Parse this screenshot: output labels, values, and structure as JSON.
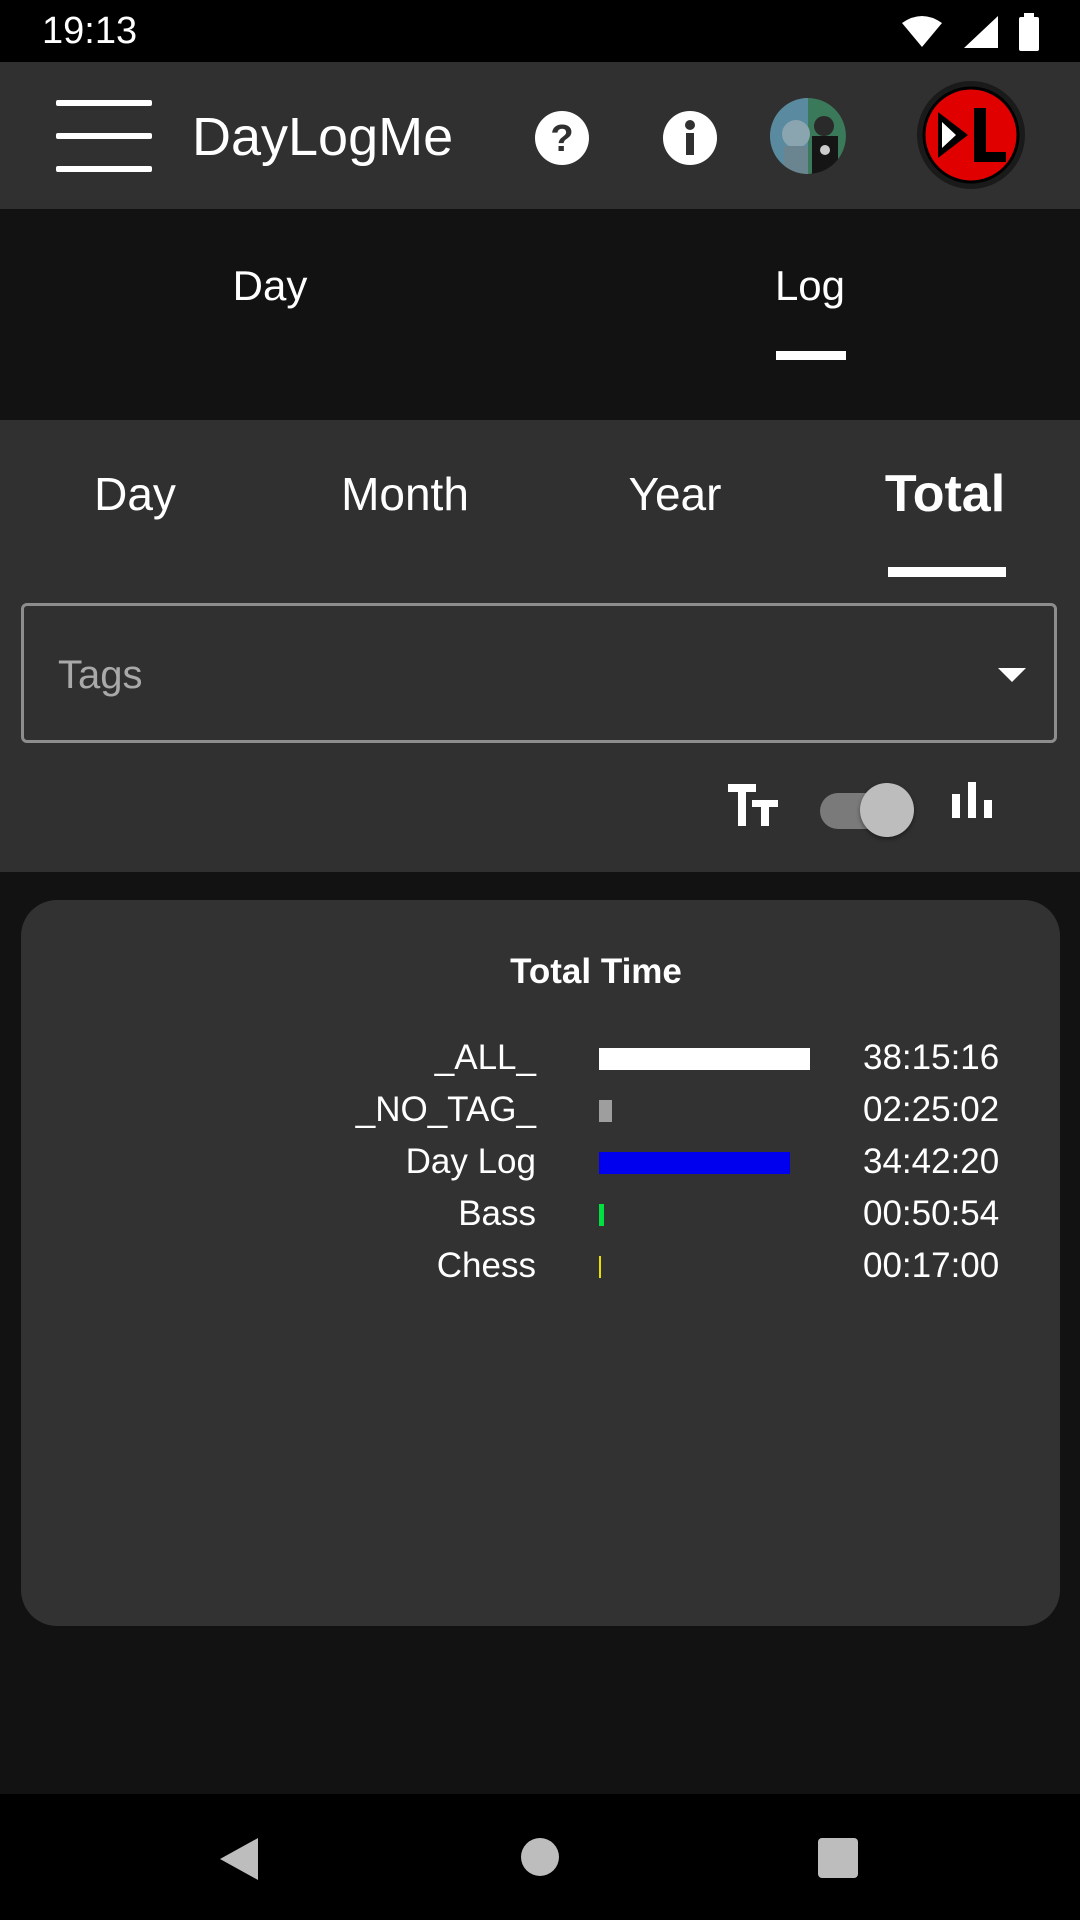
{
  "status_bar": {
    "time": "19:13",
    "icons": [
      "wifi-icon",
      "cell-signal-icon",
      "battery-icon"
    ]
  },
  "app_bar": {
    "title": "DayLogMe",
    "icons": [
      "menu-icon",
      "help-icon",
      "info-icon",
      "avatar",
      "app-logo"
    ]
  },
  "main_tabs": {
    "items": [
      {
        "label": "Day",
        "selected": false
      },
      {
        "label": "Log",
        "selected": true
      }
    ]
  },
  "sub_tabs": {
    "items": [
      {
        "label": "Day",
        "selected": false
      },
      {
        "label": "Month",
        "selected": false
      },
      {
        "label": "Year",
        "selected": false
      },
      {
        "label": "Total",
        "selected": true
      }
    ]
  },
  "tags_select": {
    "placeholder": "Tags"
  },
  "view_toggle": {
    "left_icon": "text-size-icon",
    "right_icon": "bar-chart-icon",
    "checked": true
  },
  "card": {
    "title": "Total Time",
    "rows": [
      {
        "label": "_ALL_",
        "value": "38:15:16",
        "bar_fraction": 1.0,
        "color": "#ffffff"
      },
      {
        "label": "_NO_TAG_",
        "value": "02:25:02",
        "bar_fraction": 0.063,
        "color": "#9e9e9e"
      },
      {
        "label": "Day Log",
        "value": "34:42:20",
        "bar_fraction": 0.907,
        "color": "#0000ee"
      },
      {
        "label": "Bass",
        "value": "00:50:54",
        "bar_fraction": 0.022,
        "color": "#00e040"
      },
      {
        "label": "Chess",
        "value": "00:17:00",
        "bar_fraction": 0.0074,
        "color": "#e8e000"
      }
    ]
  },
  "nav_bar": {
    "icons": [
      "back-icon",
      "home-icon",
      "recents-icon"
    ]
  }
}
